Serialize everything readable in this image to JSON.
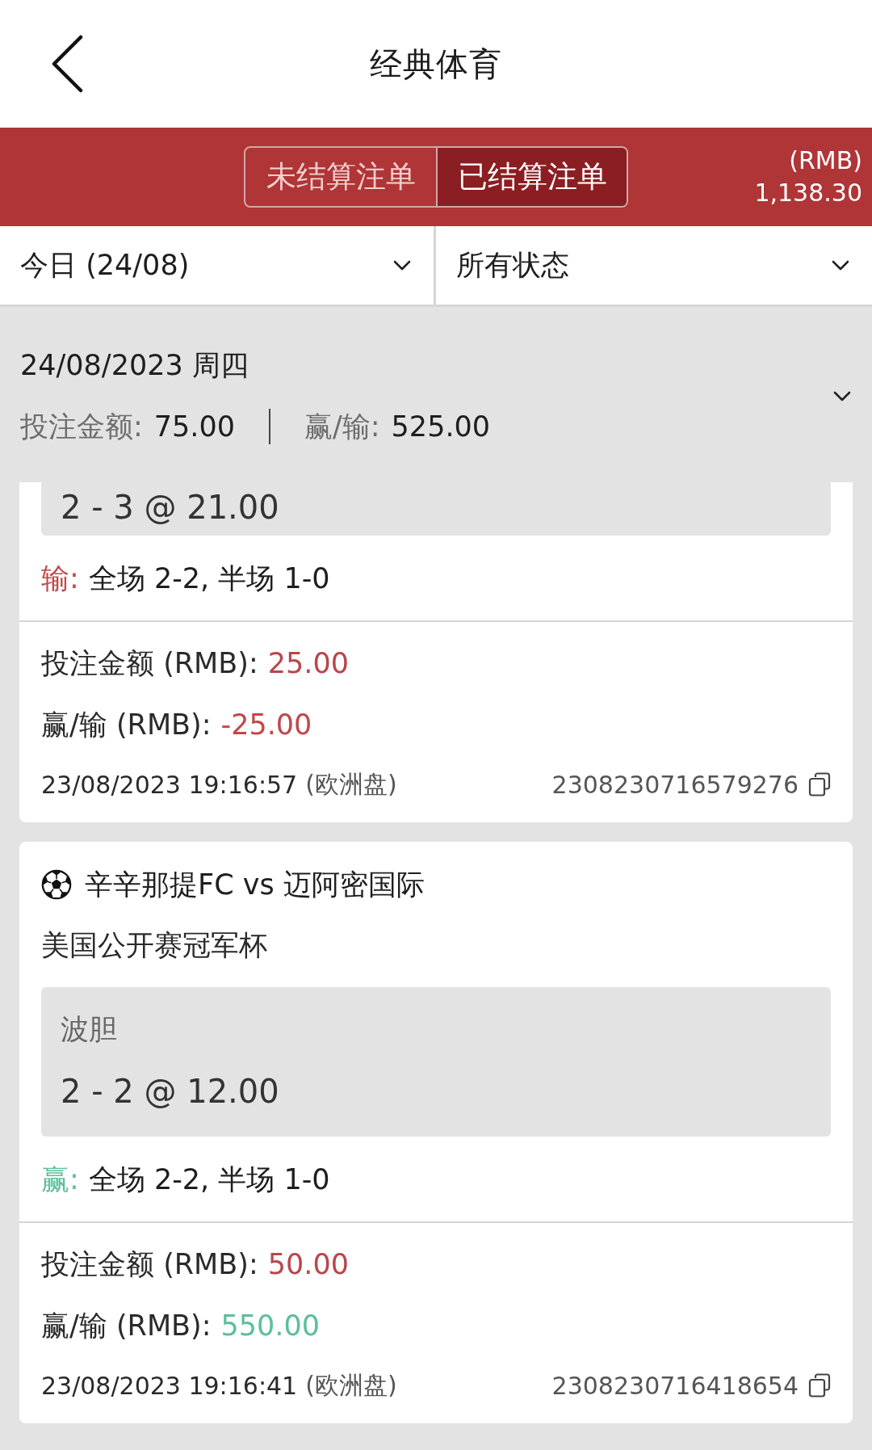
{
  "header": {
    "title": "经典体育"
  },
  "tabs": [
    {
      "label": "未结算注单",
      "selected": false
    },
    {
      "label": "已结算注单",
      "selected": true
    }
  ],
  "balance": {
    "currency": "(RMB)",
    "amount": "1,138.30"
  },
  "filters": [
    {
      "label": "今日 (24/08)"
    },
    {
      "label": "所有状态"
    }
  ],
  "date_group": {
    "date": "24/08/2023 周四",
    "summary": [
      {
        "label": "投注金额:",
        "value": "75.00"
      },
      {
        "label": "赢/输:",
        "value": "525.00"
      }
    ]
  },
  "bets": [
    {
      "kind": "lose",
      "selection": "2 - 3 @ 21.00",
      "result": {
        "label": "输:",
        "text": "全场 2-2, 半场 1-0"
      },
      "stake": {
        "label": "投注金额 (RMB):",
        "value": "25.00"
      },
      "win_loss": {
        "label": "赢/输 (RMB):",
        "value": "-25.00"
      },
      "placed": "23/08/2023 19:16:57",
      "odds_type": "(欧洲盘)",
      "bet_id": "2308230716579276"
    },
    {
      "kind": "win",
      "match": "辛辛那提FC vs 迈阿密国际",
      "league": "美国公开赛冠军杯",
      "market": "波胆",
      "selection": "2 - 2 @ 12.00",
      "result": {
        "label": "赢:",
        "text": "全场 2-2, 半场 1-0"
      },
      "stake": {
        "label": "投注金额 (RMB):",
        "value": "50.00"
      },
      "win_loss": {
        "label": "赢/输 (RMB):",
        "value": "550.00"
      },
      "placed": "23/08/2023 19:16:41",
      "odds_type": "(欧洲盘)",
      "bet_id": "2308230716418654"
    }
  ]
}
